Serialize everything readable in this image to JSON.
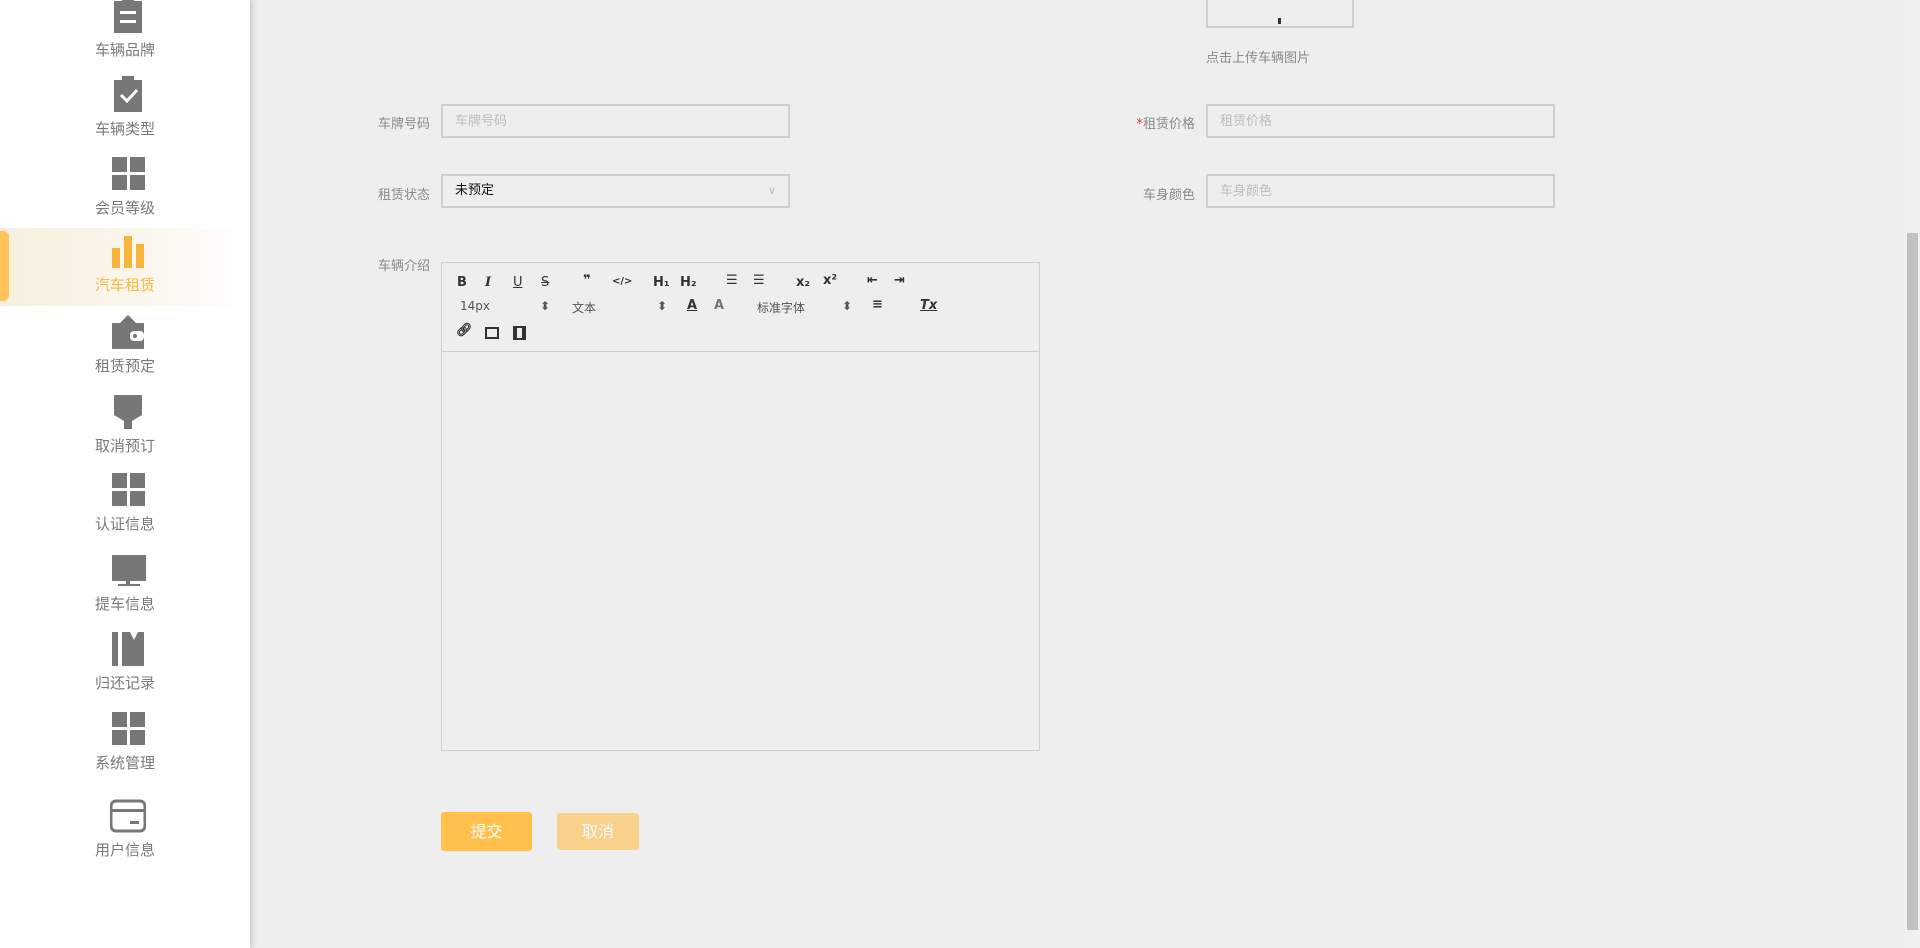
{
  "sidebar": {
    "items": [
      {
        "label": "车辆品牌",
        "icon": "clipboard-list-icon"
      },
      {
        "label": "车辆类型",
        "icon": "clipboard-check-icon"
      },
      {
        "label": "会员等级",
        "icon": "grid-icon"
      },
      {
        "label": "汽车租赁",
        "icon": "bar-chart-icon",
        "active": true
      },
      {
        "label": "租赁预定",
        "icon": "wallet-icon"
      },
      {
        "label": "取消预订",
        "icon": "brush-icon"
      },
      {
        "label": "认证信息",
        "icon": "grid-icon"
      },
      {
        "label": "提车信息",
        "icon": "monitor-icon"
      },
      {
        "label": "归还记录",
        "icon": "bookmark-book-icon"
      },
      {
        "label": "系统管理",
        "icon": "grid-icon"
      },
      {
        "label": "用户信息",
        "icon": "credit-card-icon"
      }
    ]
  },
  "upload": {
    "hint": "点击上传车辆图片"
  },
  "form": {
    "plate": {
      "label": "车牌号码",
      "placeholder": "车牌号码"
    },
    "price": {
      "required": "*",
      "label": "租赁价格",
      "placeholder": "租赁价格"
    },
    "status": {
      "label": "租赁状态",
      "value": "未预定"
    },
    "color": {
      "label": "车身颜色",
      "placeholder": "车身颜色"
    },
    "intro": {
      "label": "车辆介绍"
    }
  },
  "editor": {
    "font_size": "14px",
    "heading": "文本",
    "font": "标准字体",
    "bold": "B",
    "italic": "I",
    "underline": "U",
    "strike": "S",
    "quote": "❞",
    "code": "</>",
    "h1": "H₁",
    "h2": "H₂",
    "sub": "x₂",
    "sup": "x²",
    "clear": "Tx"
  },
  "buttons": {
    "submit": "提交",
    "cancel": "取消"
  },
  "colors": {
    "accent": "#ffc04d",
    "active_text": "#f5b93e",
    "icon": "#777777"
  }
}
